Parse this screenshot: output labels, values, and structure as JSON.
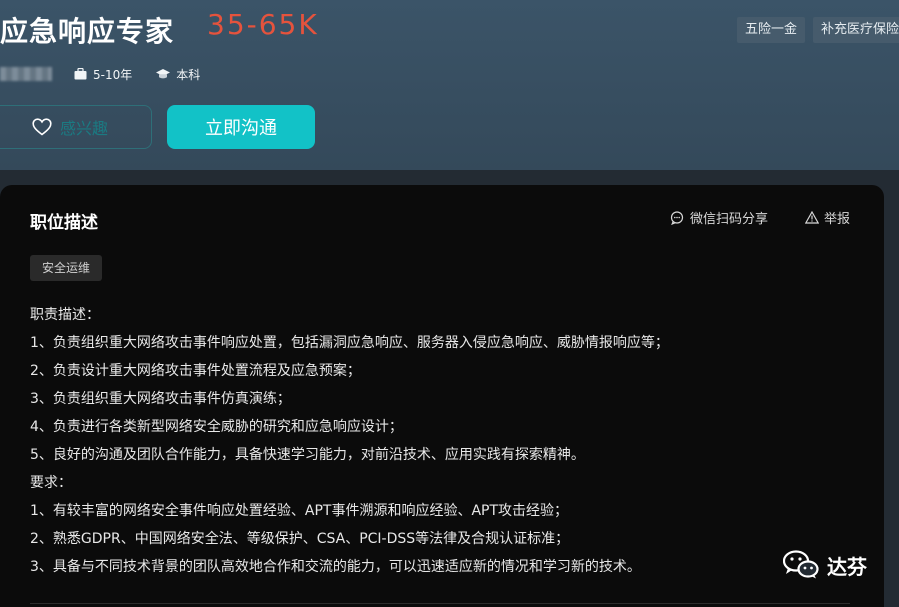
{
  "job": {
    "title": "应急响应专家",
    "salary": "35-65K",
    "experience": "5-10年",
    "education": "本科"
  },
  "welfare": [
    "五险一金",
    "补充医疗保险"
  ],
  "actions": {
    "interest_label": "感兴趣",
    "chat_label": "立即沟通"
  },
  "section": {
    "title": "职位描述",
    "share_label": "微信扫码分享",
    "report_label": "举报",
    "tag": "安全运维"
  },
  "description": [
    "职责描述：",
    "1、负责组织重大网络攻击事件响应处置，包括漏洞应急响应、服务器入侵应急响应、威胁情报响应等；",
    "2、负责设计重大网络攻击事件处置流程及应急预案；",
    "3、负责组织重大网络攻击事件仿真演练；",
    "4、负责进行各类新型网络安全威胁的研究和应急响应设计；",
    "5、良好的沟通及团队合作能力，具备快速学习能力，对前沿技术、应用实践有探索精神。",
    "要求：",
    "1、有较丰富的网络安全事件响应处置经验、APT事件溯源和响应经验、APT攻击经验；",
    "2、熟悉GDPR、中国网络安全法、等级保护、CSA、PCI-DSS等法律及合规认证标准；",
    "3、具备与不同技术背景的团队高效地合作和交流的能力，可以迅速适应新的情况和学习新的技术。"
  ],
  "watermark": {
    "text": "达芬",
    "icon": "wechat-icon"
  },
  "icons": {
    "experience": "briefcase-icon",
    "education": "graduation-cap-icon",
    "interest": "heart-icon",
    "share": "chat-bubble-icon",
    "report": "warning-icon"
  },
  "colors": {
    "salary": "#e5533d",
    "primary_button": "#12c2c7",
    "header_bg": "#3b5468",
    "card_bg": "#0b0b0b"
  }
}
